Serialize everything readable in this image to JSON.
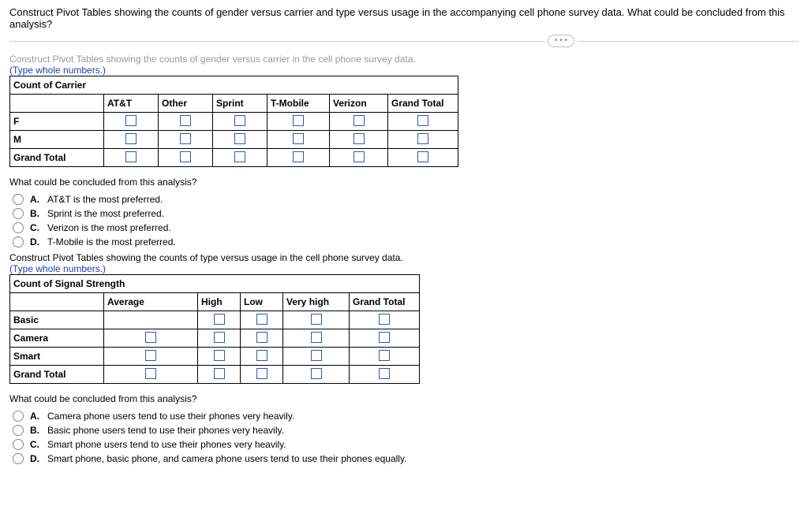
{
  "header": {
    "question": "Construct Pivot Tables showing the counts of gender versus carrier and type versus usage in the accompanying cell phone survey data. What could be concluded from this analysis?",
    "more": "• • •"
  },
  "section1": {
    "faded_instruction": "Construct Pivot Tables showing the counts of gender versus carrier in the cell phone survey data.",
    "type_hint": "(Type whole numbers.)",
    "title": "Count of Carrier",
    "cols": [
      "AT&T",
      "Other",
      "Sprint",
      "T-Mobile",
      "Verizon",
      "Grand Total"
    ],
    "rows": [
      "F",
      "M",
      "Grand Total"
    ],
    "question": "What could be concluded from this analysis?",
    "options": [
      {
        "key": "A.",
        "text": "AT&T is the most preferred."
      },
      {
        "key": "B.",
        "text": "Sprint is the most preferred."
      },
      {
        "key": "C.",
        "text": "Verizon is the most preferred."
      },
      {
        "key": "D.",
        "text": "T-Mobile is the most preferred."
      }
    ]
  },
  "section2": {
    "instruction": "Construct Pivot Tables showing the counts of type versus usage in the cell phone survey data.",
    "type_hint": "(Type whole numbers.)",
    "title": "Count of Signal Strength",
    "cols": [
      "Average",
      "High",
      "Low",
      "Very high",
      "Grand Total"
    ],
    "rows": [
      "Basic",
      "Camera",
      "Smart",
      "Grand Total"
    ],
    "question": "What could be concluded from this analysis?",
    "options": [
      {
        "key": "A.",
        "text": "Camera phone users tend to use their phones very heavily."
      },
      {
        "key": "B.",
        "text": "Basic phone users tend to use their phones very heavily."
      },
      {
        "key": "C.",
        "text": "Smart phone users tend to use their phones very heavily."
      },
      {
        "key": "D.",
        "text": "Smart phone, basic phone, and camera phone users tend to use their phones equally."
      }
    ]
  }
}
